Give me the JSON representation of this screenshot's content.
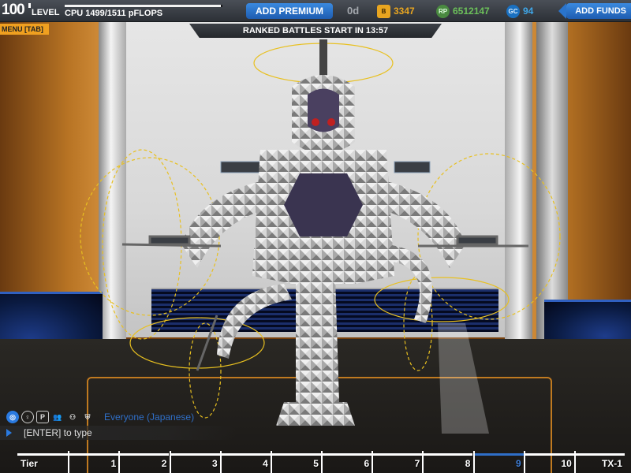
{
  "hud": {
    "level_number": "100",
    "level_label": "LEVEL",
    "cpu_text": "CPU 1499/1511 pFLOPS",
    "cpu_ratio": 0.992,
    "add_premium_label": "ADD PREMIUM",
    "premium_days": "0d",
    "bits_icon": "bits-currency-icon",
    "bits_value": "3347",
    "rp_icon": "robopoints-icon",
    "rp_value": "6512147",
    "gc_icon": "galaxy-coins-icon",
    "gc_value": "94",
    "add_funds_label": "ADD FUNDS",
    "menu_tab_label": "MENU [TAB]",
    "ranked_text": "RANKED BATTLES START IN 13:57"
  },
  "chat": {
    "icons": [
      "globe-icon",
      "person-icon",
      "p-icon",
      "friends-icon",
      "group-icon",
      "clan-icon"
    ],
    "channel": "Everyone (Japanese)",
    "input_hint": "[ENTER] to type"
  },
  "tiers": {
    "items": [
      "Tier",
      "1",
      "2",
      "3",
      "4",
      "5",
      "6",
      "7",
      "8",
      "9",
      "10",
      "TX-1"
    ],
    "active_index": 9
  },
  "colors": {
    "accent_blue": "#2f6fc8",
    "bits_orange": "#e8a520",
    "rp_green": "#6cc05a",
    "gc_blue": "#3fa6e8",
    "menu_orange": "#f0a020"
  }
}
